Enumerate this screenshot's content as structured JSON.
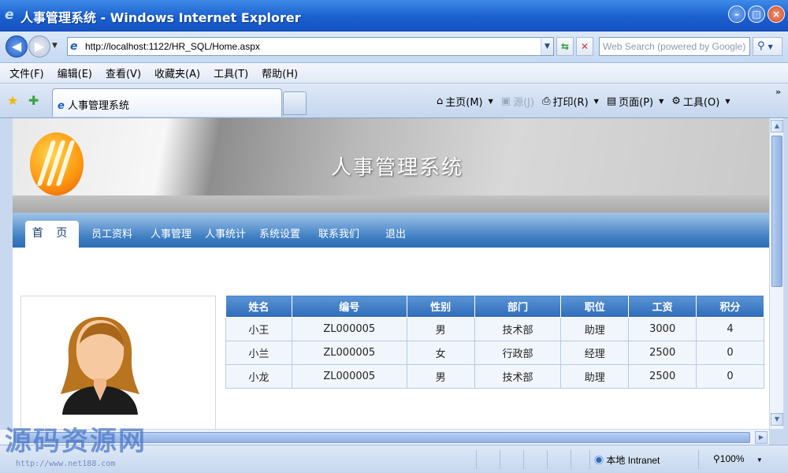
{
  "window": {
    "title": "人事管理系统 - Windows Internet Explorer"
  },
  "address_bar": {
    "url": "http://localhost:1122/HR_SQL/Home.aspx",
    "search_placeholder": "Web Search (powered by Google)"
  },
  "menu": [
    "文件(F)",
    "编辑(E)",
    "查看(V)",
    "收藏夹(A)",
    "工具(T)",
    "帮助(H)"
  ],
  "tab": {
    "label": "人事管理系统"
  },
  "command_bar": {
    "home": "主页(M)",
    "feeds": "源(J)",
    "print": "打印(R)",
    "page": "页面(P)",
    "tools": "工具(O)"
  },
  "site": {
    "title": "人事管理系统",
    "nav": [
      "首 页",
      "员工资料",
      "人事管理",
      "人事统计",
      "系统设置",
      "联系我们",
      "退出"
    ],
    "active_nav": "首 页"
  },
  "staff_table": {
    "headers": [
      "姓名",
      "编号",
      "性别",
      "部门",
      "职位",
      "工资",
      "积分"
    ],
    "rows": [
      [
        "小王",
        "ZL000005",
        "男",
        "技术部",
        "助理",
        "3000",
        "4"
      ],
      [
        "小兰",
        "ZL000005",
        "女",
        "行政部",
        "经理",
        "2500",
        "0"
      ],
      [
        "小龙",
        "ZL000005",
        "男",
        "技术部",
        "助理",
        "2500",
        "0"
      ]
    ]
  },
  "status_bar": {
    "zone": "本地 Intranet",
    "zoom": "100%"
  },
  "watermark": {
    "text": "源码资源网",
    "url": "http://www.net188.com"
  },
  "colors": {
    "title_bar": "#1a5fcf",
    "nav_strip": "#3f7fc3",
    "table_header": "#2f6bb8",
    "table_cell": "#f1f6fc"
  }
}
